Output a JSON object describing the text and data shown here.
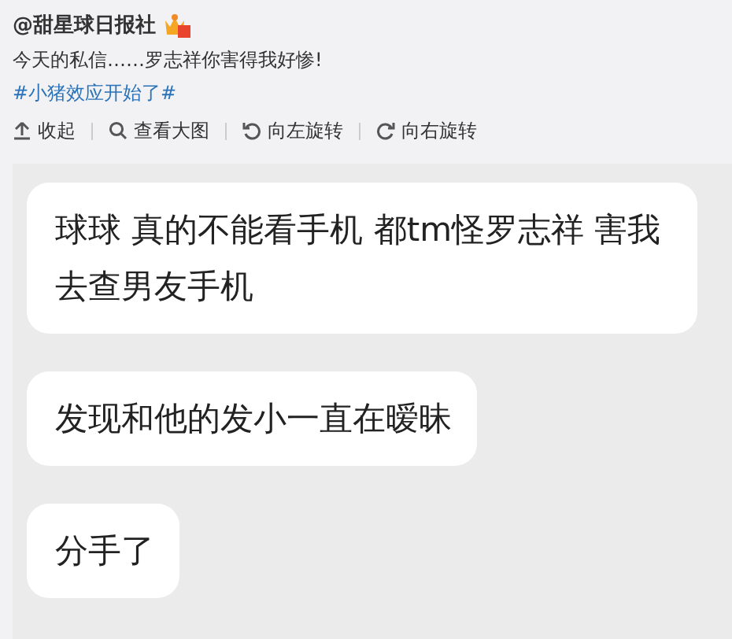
{
  "post": {
    "author": "@甜星球日报社",
    "text": "今天的私信……罗志祥你害得我好惨!",
    "hashtag": "#小猪效应开始了#"
  },
  "toolbar": [
    {
      "kind": "collapse",
      "label": "收起"
    },
    {
      "kind": "zoom",
      "label": "查看大图"
    },
    {
      "kind": "rotate_left",
      "label": "向左旋转"
    },
    {
      "kind": "rotate_right",
      "label": "向右旋转"
    }
  ],
  "image": {
    "messages": [
      "球球 真的不能看手机 都tm怪罗志祥 害我去查男友手机",
      "发现和他的发小一直在暧昧",
      "分手了"
    ]
  }
}
